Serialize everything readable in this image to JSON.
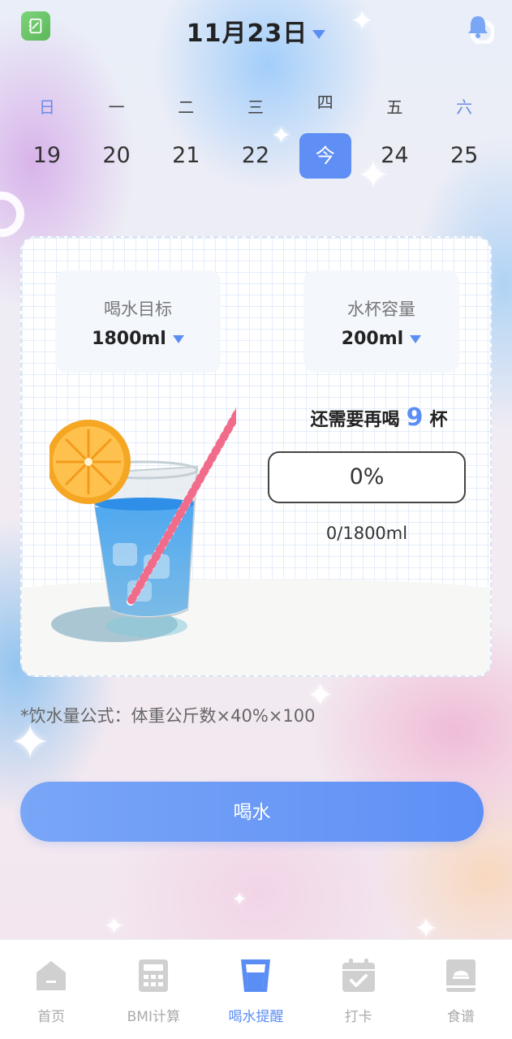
{
  "header": {
    "date": "11月23日"
  },
  "week": {
    "weekdays": [
      "日",
      "一",
      "二",
      "三",
      "四",
      "五",
      "六"
    ],
    "days": [
      "19",
      "20",
      "21",
      "22",
      "今",
      "24",
      "25"
    ]
  },
  "card": {
    "goal_label": "喝水目标",
    "goal_value": "1800ml",
    "cup_label": "水杯容量",
    "cup_value": "200ml",
    "need_prefix": "还需要再喝",
    "need_count": "9",
    "need_suffix": "杯",
    "progress_text": "0%",
    "progress_fraction": 0,
    "amount_text": "0/1800ml"
  },
  "formula": "*饮水量公式：体重公斤数×40%×100",
  "drink_button": "喝水",
  "tabs": [
    {
      "label": "首页",
      "icon": "home-icon"
    },
    {
      "label": "BMI计算",
      "icon": "calculator-icon"
    },
    {
      "label": "喝水提醒",
      "icon": "cup-icon",
      "active": true
    },
    {
      "label": "打卡",
      "icon": "calendar-check-icon"
    },
    {
      "label": "食谱",
      "icon": "recipe-book-icon"
    }
  ],
  "colors": {
    "accent": "#5b8ef5",
    "today_bg": "#5f8ff4",
    "button_gradient_start": "#79a6f7",
    "button_gradient_end": "#5e8ff5",
    "inactive_tab": "#aaaaaa"
  }
}
